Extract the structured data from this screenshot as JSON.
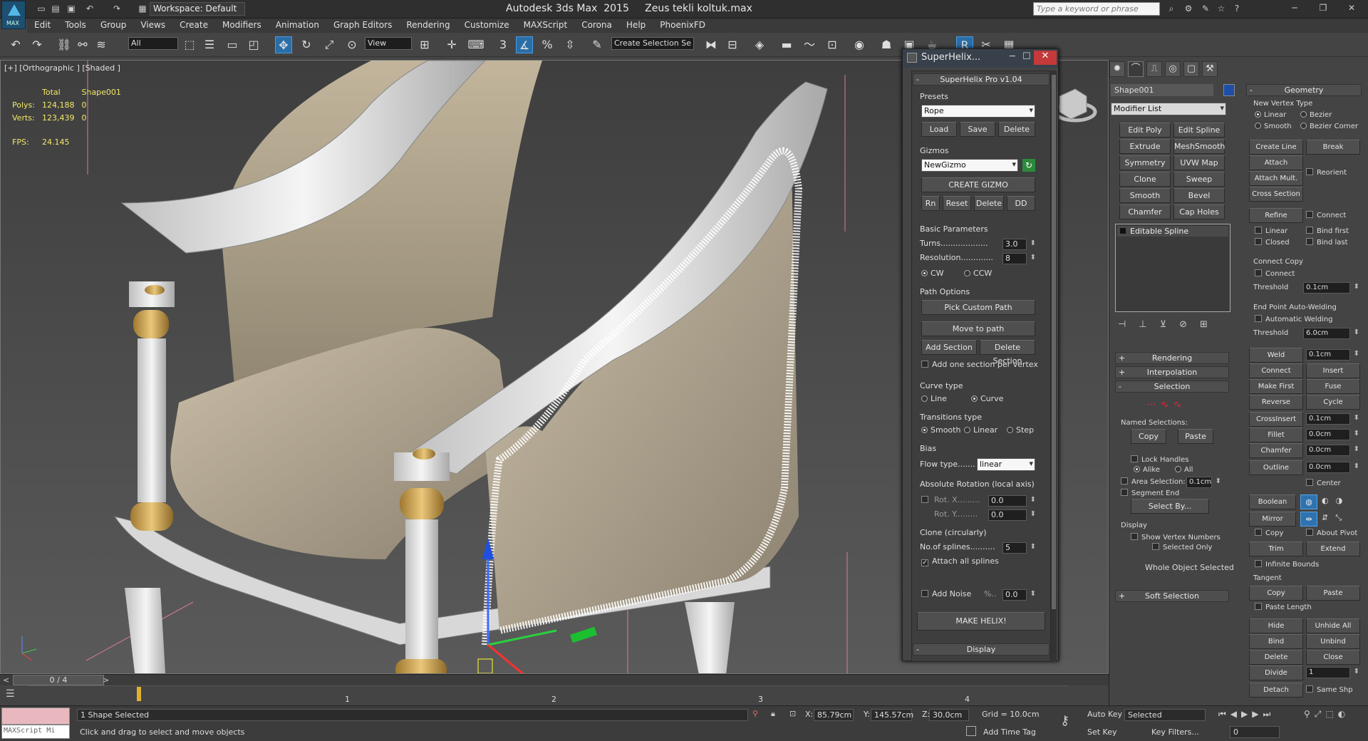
{
  "app": {
    "title": "Autodesk 3ds Max  2015     Zeus tekli koltuk.max",
    "workspace": "Workspace: Default",
    "search_placeholder": "Type a keyword or phrase",
    "logo_text": "MAX"
  },
  "menu": [
    "Edit",
    "Tools",
    "Group",
    "Views",
    "Create",
    "Modifiers",
    "Animation",
    "Graph Editors",
    "Rendering",
    "Customize",
    "MAXScript",
    "Corona",
    "Help",
    "PhoenixFD"
  ],
  "toolbar": {
    "filter": "All",
    "ref_coord": "View",
    "sel_set": "Create Selection Se"
  },
  "viewport": {
    "label": "[+] [Orthographic ] [Shaded ]",
    "stats": {
      "head_total": "Total",
      "head_obj": "Shape001",
      "polys_label": "Polys:",
      "polys_total": "124,188",
      "polys_obj": "0",
      "verts_label": "Verts:",
      "verts_total": "123,439",
      "verts_obj": "0",
      "fps_label": "FPS:",
      "fps_value": "24.145"
    }
  },
  "timeline": {
    "frame": "0 / 4",
    "ticks": [
      "1",
      "2",
      "3",
      "4"
    ]
  },
  "status": {
    "maxscript": "MAXScript Mi",
    "selected": "1 Shape Selected",
    "prompt": "Click and drag to select and move objects",
    "x_label": "X:",
    "x": "85.79cm",
    "y_label": "Y:",
    "y": "145.57cm",
    "z_label": "Z:",
    "z": "30.0cm",
    "grid": "Grid = 10.0cm",
    "add_time_tag": "Add Time Tag",
    "auto_key": "Auto Key",
    "set_key": "Set Key",
    "key_mode": "Selected",
    "key_filters": "Key Filters...",
    "frame_field": "0"
  },
  "superhelix": {
    "title": "SuperHelix...",
    "rollout": "SuperHelix Pro v1.04",
    "presets_label": "Presets",
    "preset": "Rope",
    "load": "Load",
    "save": "Save",
    "delete": "Delete",
    "gizmos_label": "Gizmos",
    "gizmo": "NewGizmo",
    "create_gizmo": "CREATE GIZMO",
    "rn": "Rn",
    "reset": "Reset",
    "gdelete": "Delete",
    "dd": "DD",
    "basic_label": "Basic Parameters",
    "turns_label": "Turns...................",
    "turns": "3.0",
    "res_label": "Resolution.............",
    "res": "8",
    "cw": "CW",
    "ccw": "CCW",
    "path_label": "Path Options",
    "pick_custom": "Pick Custom Path",
    "move_to_path": "Move to path",
    "add_section": "Add Section",
    "delete_section": "Delete Section",
    "add_one": "Add one section per vertex",
    "curve_label": "Curve type",
    "line": "Line",
    "curve": "Curve",
    "trans_label": "Transitions type",
    "smooth": "Smooth",
    "linear": "Linear",
    "step": "Step",
    "bias_label": "Bias",
    "flow_label": "Flow type.......",
    "flow": "linear",
    "absrot_label": "Absolute Rotation (local axis)",
    "rotx_label": "Rot. X.........",
    "rotx": "0.0",
    "roty_label": "Rot. Y.........",
    "roty": "0.0",
    "clone_label": "Clone (circularly)",
    "nsplines_label": "No.of splines..........",
    "nsplines": "5",
    "attach_all": "Attach all splines",
    "add_noise": "Add Noise",
    "noise_pct": "%..",
    "noise": "0.0",
    "make_helix": "MAKE HELIX!",
    "display": "Display"
  },
  "panel": {
    "object_name": "Shape001",
    "modifier_list": "Modifier List",
    "mod_buttons": [
      "Edit Poly",
      "Edit Spline",
      "Extrude",
      "MeshSmooth",
      "Symmetry",
      "UVW Map",
      "Clone",
      "Sweep",
      "Smooth",
      "Bevel",
      "Chamfer",
      "Cap Holes"
    ],
    "stack_item": "Editable Spline",
    "rollouts": {
      "rendering": "Rendering",
      "interpolation": "Interpolation",
      "selection": "Selection",
      "soft_selection": "Soft Selection"
    },
    "named_sel": "Named Selections:",
    "copy": "Copy",
    "paste": "Paste",
    "lock_handles": "Lock Handles",
    "alike": "Alike",
    "all": "All",
    "area_sel": "Area Selection:",
    "area_val": "0.1cm",
    "segment_end": "Segment End",
    "select_by": "Select By...",
    "display": "Display",
    "show_vertex_numbers": "Show Vertex Numbers",
    "selected_only": "Selected Only",
    "whole_object": "Whole Object Selected"
  },
  "geometry": {
    "title": "Geometry",
    "new_vertex_type": "New Vertex Type",
    "linear": "Linear",
    "bezier": "Bezier",
    "smooth": "Smooth",
    "bezier_corner": "Bezier Corner",
    "create_line": "Create Line",
    "break": "Break",
    "attach": "Attach",
    "reorient": "Reorient",
    "attach_mult": "Attach Mult.",
    "cross_section": "Cross Section",
    "refine": "Refine",
    "connect": "Connect",
    "linear2": "Linear",
    "bind_first": "Bind first",
    "closed": "Closed",
    "bind_last": "Bind last",
    "connect_copy": "Connect Copy",
    "connect2": "Connect",
    "threshold": "Threshold",
    "threshold_val": "0.1cm",
    "end_point": "End Point Auto-Welding",
    "auto_weld": "Automatic Welding",
    "threshold2_val": "6.0cm",
    "weld": "Weld",
    "weld_val": "0.1cm",
    "connect3": "Connect",
    "insert": "Insert",
    "make_first": "Make First",
    "fuse": "Fuse",
    "reverse": "Reverse",
    "cycle": "Cycle",
    "crossinsert": "CrossInsert",
    "crossinsert_val": "0.1cm",
    "fillet": "Fillet",
    "fillet_val": "0.0cm",
    "chamfer": "Chamfer",
    "chamfer_val": "0.0cm",
    "outline": "Outline",
    "outline_val": "0.0cm",
    "center": "Center",
    "boolean": "Boolean",
    "mirror": "Mirror",
    "copy": "Copy",
    "about_pivot": "About Pivot",
    "trim": "Trim",
    "extend": "Extend",
    "infinite_bounds": "Infinite Bounds",
    "tangent": "Tangent",
    "tcopy": "Copy",
    "tpaste": "Paste",
    "paste_length": "Paste Length",
    "hide": "Hide",
    "unhide_all": "Unhide All",
    "bind": "Bind",
    "unbind": "Unbind",
    "delete": "Delete",
    "close": "Close",
    "divide": "Divide",
    "divide_val": "1",
    "detach": "Detach",
    "same_shp": "Same Shp"
  }
}
